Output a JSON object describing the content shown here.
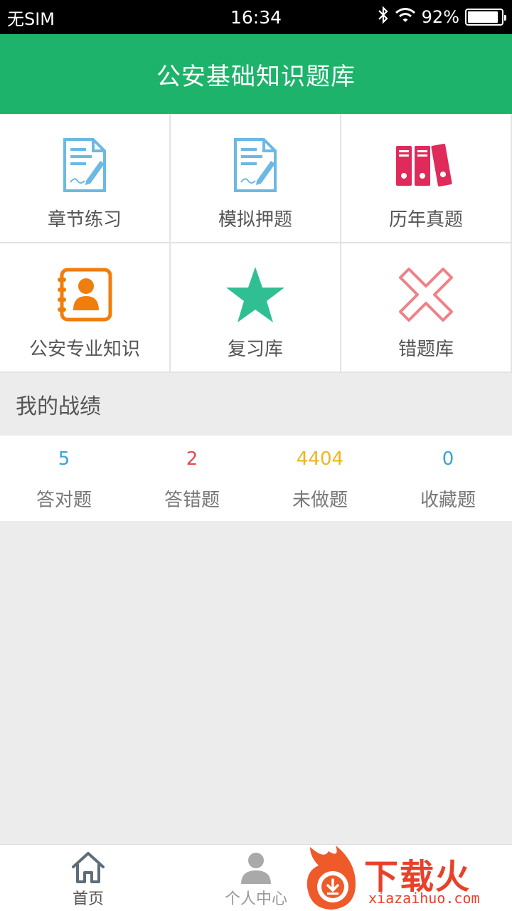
{
  "status_bar": {
    "carrier": "无SIM",
    "time": "16:34",
    "battery": "92%",
    "battery_level": 0.92
  },
  "header": {
    "title": "公安基础知识题库"
  },
  "grid": [
    {
      "label": "章节练习",
      "icon": "document-pen-icon",
      "color": "#6cb9e4"
    },
    {
      "label": "模拟押题",
      "icon": "document-pen-icon",
      "color": "#6cb9e4"
    },
    {
      "label": "历年真题",
      "icon": "binders-icon",
      "color": "#e02a5a"
    },
    {
      "label": "公安专业知识",
      "icon": "contact-book-icon",
      "color": "#f07d0c"
    },
    {
      "label": "复习库",
      "icon": "star-icon",
      "color": "#2fbf93"
    },
    {
      "label": "错题库",
      "icon": "cross-icon",
      "color": "#f08187"
    }
  ],
  "stats_section": {
    "title": "我的战绩",
    "items": [
      {
        "value": "5",
        "label": "答对题",
        "color": "#3fa1d8"
      },
      {
        "value": "2",
        "label": "答错题",
        "color": "#e34b4b"
      },
      {
        "value": "4404",
        "label": "未做题",
        "color": "#f0b51d"
      },
      {
        "value": "0",
        "label": "收藏题",
        "color": "#3fa1d8"
      }
    ]
  },
  "bottom_nav": {
    "home_label": "首页",
    "profile_label": "个人中心"
  },
  "watermark": {
    "text": "下载火",
    "sub": "xiazaihuo.com"
  }
}
